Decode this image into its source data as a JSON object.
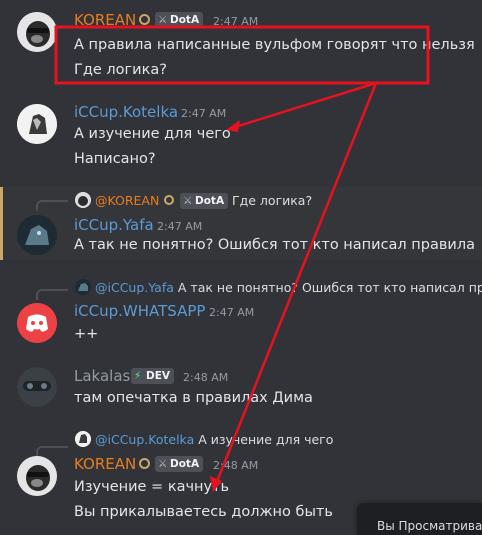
{
  "messages": [
    {
      "author": "KOREAN",
      "author_color": "#e67e22",
      "badge": "DotA",
      "time": "2:47 AM",
      "lines": [
        "А правила написанные вульфом говорят что нельзя",
        "Где логика?"
      ]
    },
    {
      "author": "iCCup.Kotelka",
      "author_color": "#5b9bd5",
      "time": "2:47 AM",
      "lines": [
        "А изучение для чего",
        "Написано?"
      ]
    },
    {
      "reply": {
        "name": "@KOREAN",
        "badge": "DotA",
        "text": "Где логика?"
      },
      "author": "iCCup.Yafa",
      "author_color": "#5b9bd5",
      "time": "2:47 AM",
      "lines": [
        "А так не понятно? Ошибся тот кто написал правила"
      ]
    },
    {
      "reply": {
        "name": "@iCCup.Yafa",
        "text": "А так не понятно? Ошибся тот кто написал правил"
      },
      "author": "iCCup.WHATSAPP",
      "author_color": "#5b9bd5",
      "time": "2:47 AM",
      "lines": [
        "++"
      ]
    },
    {
      "author": "Lakalas",
      "author_color": "#949ba4",
      "badge": "DEV",
      "time": "2:48 AM",
      "lines": [
        "там опечатка в правилах Дима"
      ]
    },
    {
      "reply": {
        "name": "@iCCup.Kotelka",
        "text": "А изучение для чего"
      },
      "author": "KOREAN",
      "author_color": "#e67e22",
      "badge": "DotA",
      "time": "2:48 AM",
      "lines": [
        "Изучение = качнуть",
        "Вы прикалываетесь должно быть"
      ]
    }
  ],
  "tooltip": {
    "text": "Вы Просматрива"
  },
  "annotation_color": "#e8111f"
}
